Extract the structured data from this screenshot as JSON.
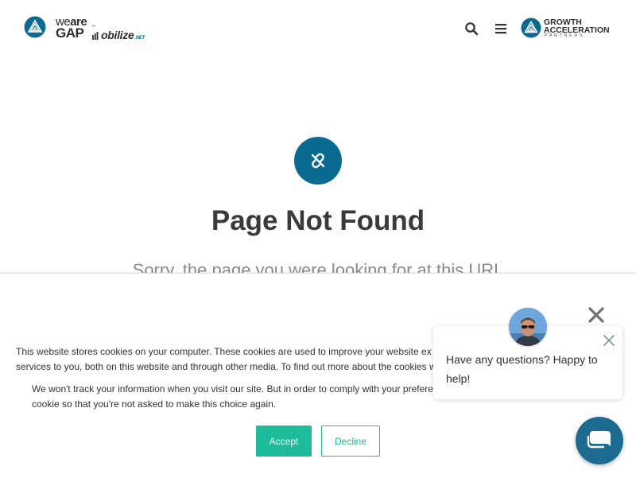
{
  "header": {
    "brand": {
      "we": "we",
      "are": "are",
      "gap": "GAP",
      "tm": "™",
      "mobilize": "obilize",
      "net": ".NET"
    },
    "search_icon": "search-icon",
    "menu_icon": "hamburger-menu-icon",
    "partner_logo": {
      "line1": "GROWTH",
      "line2": "ACCELERATION",
      "line3": "PARTNERS"
    }
  },
  "main": {
    "icon": "broken-link-icon",
    "title": "Page Not Found",
    "subtitle": "Sorry, the page you were looking for at this URL"
  },
  "cookie_banner": {
    "text1": "This website stores cookies on your computer. These cookies are used to improve your website ex\nservices to you, both on this website and through other media. To find out more about the cookies w",
    "text2": "We won't track your information when you visit our site. But in order to comply with your prefere\ncookie so that you're not asked to make this choice again.",
    "accept_label": "Accept",
    "decline_label": "Decline"
  },
  "chat": {
    "message": "Have any questions? Happy to help!",
    "close_icon": "close-icon",
    "launcher_icon": "chat-bubble-icon"
  },
  "colors": {
    "brand_blue": "#0b6a8f",
    "accent_green": "#1ebb9b",
    "chat_blue": "#1e6b91",
    "text_dark": "#3a3a3a"
  }
}
